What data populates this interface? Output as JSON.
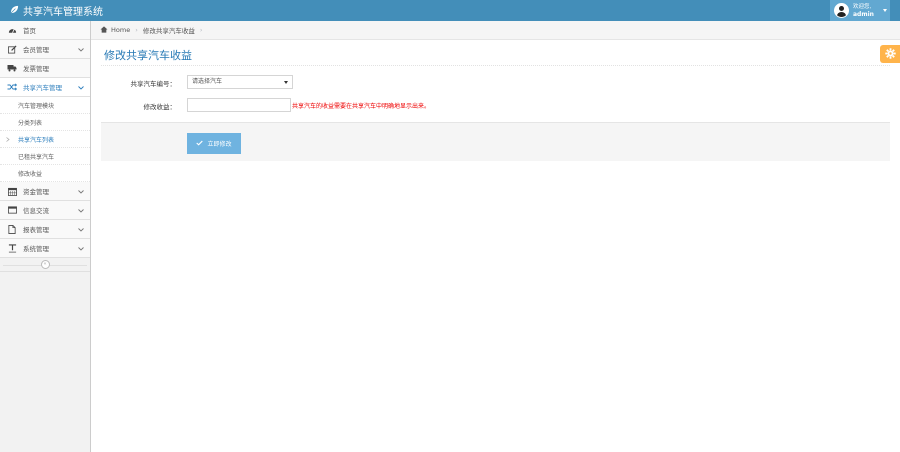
{
  "app": {
    "title": "共享汽车管理系统"
  },
  "user": {
    "welcome": "欢迎您,",
    "name": "admin"
  },
  "sidebar": {
    "items": [
      {
        "label": "首页",
        "icon": "dashboard-icon"
      },
      {
        "label": "会员管理",
        "icon": "edit-icon"
      },
      {
        "label": "发票管理",
        "icon": "truck-icon"
      },
      {
        "label": "共享汽车管理",
        "icon": "random-icon"
      },
      {
        "label": "资金管理",
        "icon": "calendar-icon"
      },
      {
        "label": "信息交流",
        "icon": "window-icon"
      },
      {
        "label": "报表管理",
        "icon": "file-icon"
      },
      {
        "label": "系统管理",
        "icon": "text-width-icon"
      }
    ],
    "sub_items": [
      {
        "label": "汽车管理模块"
      },
      {
        "label": "分类列表"
      },
      {
        "label": "共享汽车列表"
      },
      {
        "label": "已租共享汽车"
      },
      {
        "label": "修改收益"
      }
    ]
  },
  "breadcrumb": {
    "home": "Home",
    "current": "修改共享汽车收益"
  },
  "page": {
    "title": "修改共享汽车收益"
  },
  "form": {
    "car_label": "共享汽车编号：",
    "car_value": "请选择汽车",
    "income_label": "修改收益：",
    "income_value": "",
    "hint": "共享汽车的收益需要在共享汽车中明确地显示出来。"
  },
  "actions": {
    "submit_label": "立即修改"
  },
  "colors": {
    "topbar": "#438eb9",
    "accent": "#2679b5",
    "button": "#6fb3e0",
    "settings": "#ffb44b",
    "hint": "#ee0000"
  }
}
